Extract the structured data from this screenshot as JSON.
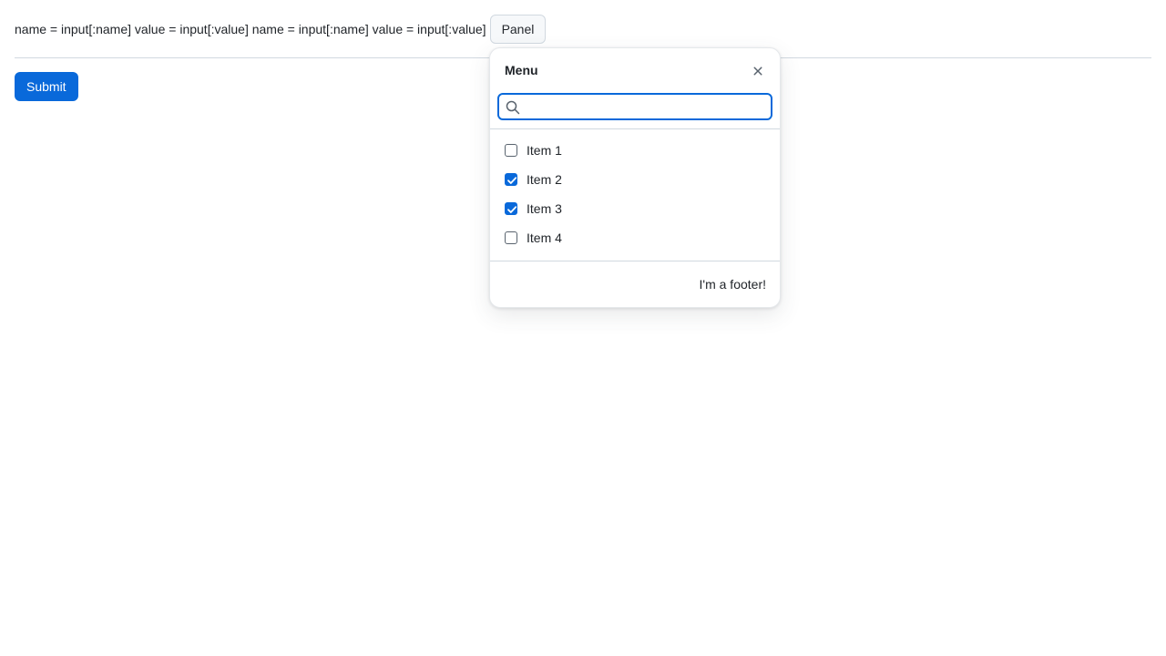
{
  "top_row": {
    "debug_text": "name = input[:name] value = input[:value] name = input[:name] value = input[:value]",
    "panel_button_label": "Panel"
  },
  "submit_label": "Submit",
  "overlay": {
    "title": "Menu",
    "close_icon": "close-icon",
    "search": {
      "icon": "search-icon",
      "value": "",
      "placeholder": ""
    },
    "items": [
      {
        "label": "Item 1",
        "checked": false
      },
      {
        "label": "Item 2",
        "checked": true
      },
      {
        "label": "Item 3",
        "checked": true
      },
      {
        "label": "Item 4",
        "checked": false
      }
    ],
    "footer": "I'm a footer!"
  },
  "colors": {
    "accent": "#0969da",
    "border": "#d1d9e0",
    "text": "#1f2328"
  }
}
